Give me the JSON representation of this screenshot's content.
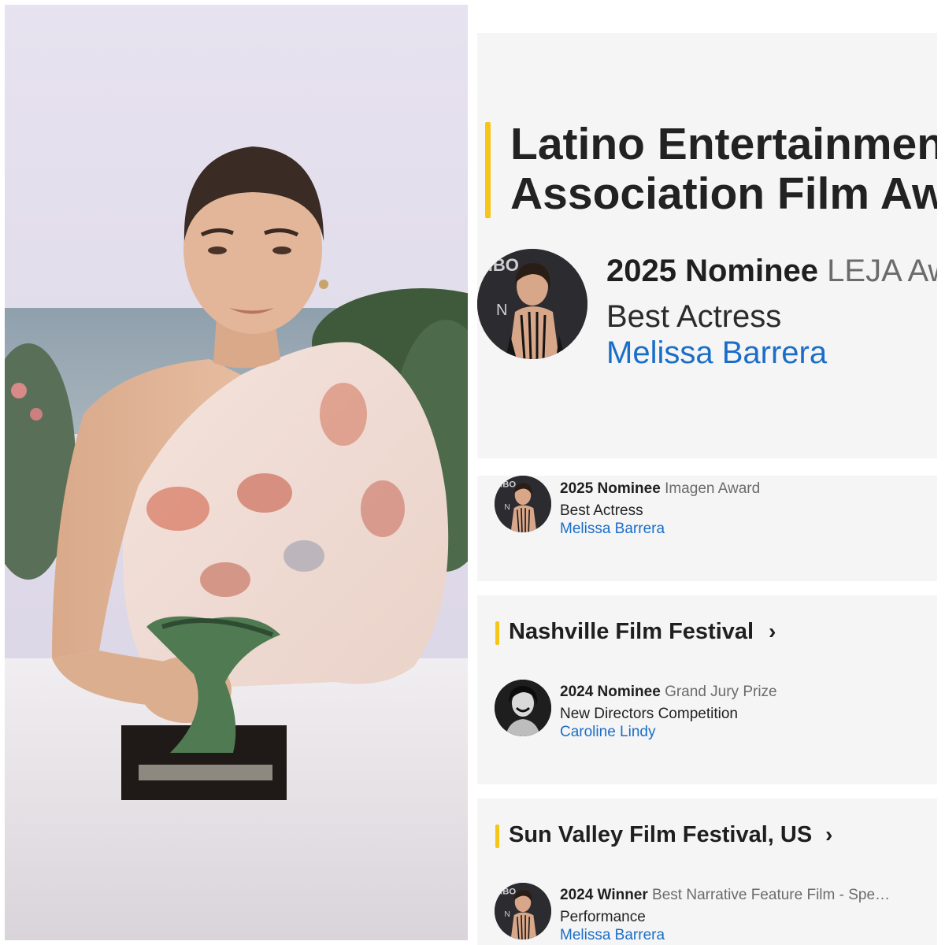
{
  "header": {
    "title_line1": "Latino Entertainment",
    "title_line2": "Association Film Awards"
  },
  "featured_nomination": {
    "status": "2025 Nominee",
    "award": "LEJA Award",
    "category": "Best Actress",
    "nominee": "Melissa Barrera"
  },
  "nominations": [
    {
      "status": "2025 Nominee",
      "award": "Imagen Award",
      "category": "Best Actress",
      "nominee": "Melissa Barrera"
    }
  ],
  "festivals": [
    {
      "name": "Nashville Film Festival",
      "nominations": [
        {
          "status": "2024 Nominee",
          "award": "Grand Jury Prize",
          "category": "New Directors Competition",
          "nominee": "Caroline Lindy"
        }
      ]
    },
    {
      "name": "Sun Valley Film Festival, US",
      "nominations": [
        {
          "status": "2024 Winner",
          "award": "Best Narrative Feature Film - Spe…",
          "category": "Performance",
          "nominee": "Melissa Barrera"
        }
      ]
    }
  ],
  "colors": {
    "accent": "#f5c518",
    "link": "#1a6ec8",
    "card_bg": "#f5f5f5"
  },
  "icons": {
    "chevron": "chevron-right-icon"
  }
}
